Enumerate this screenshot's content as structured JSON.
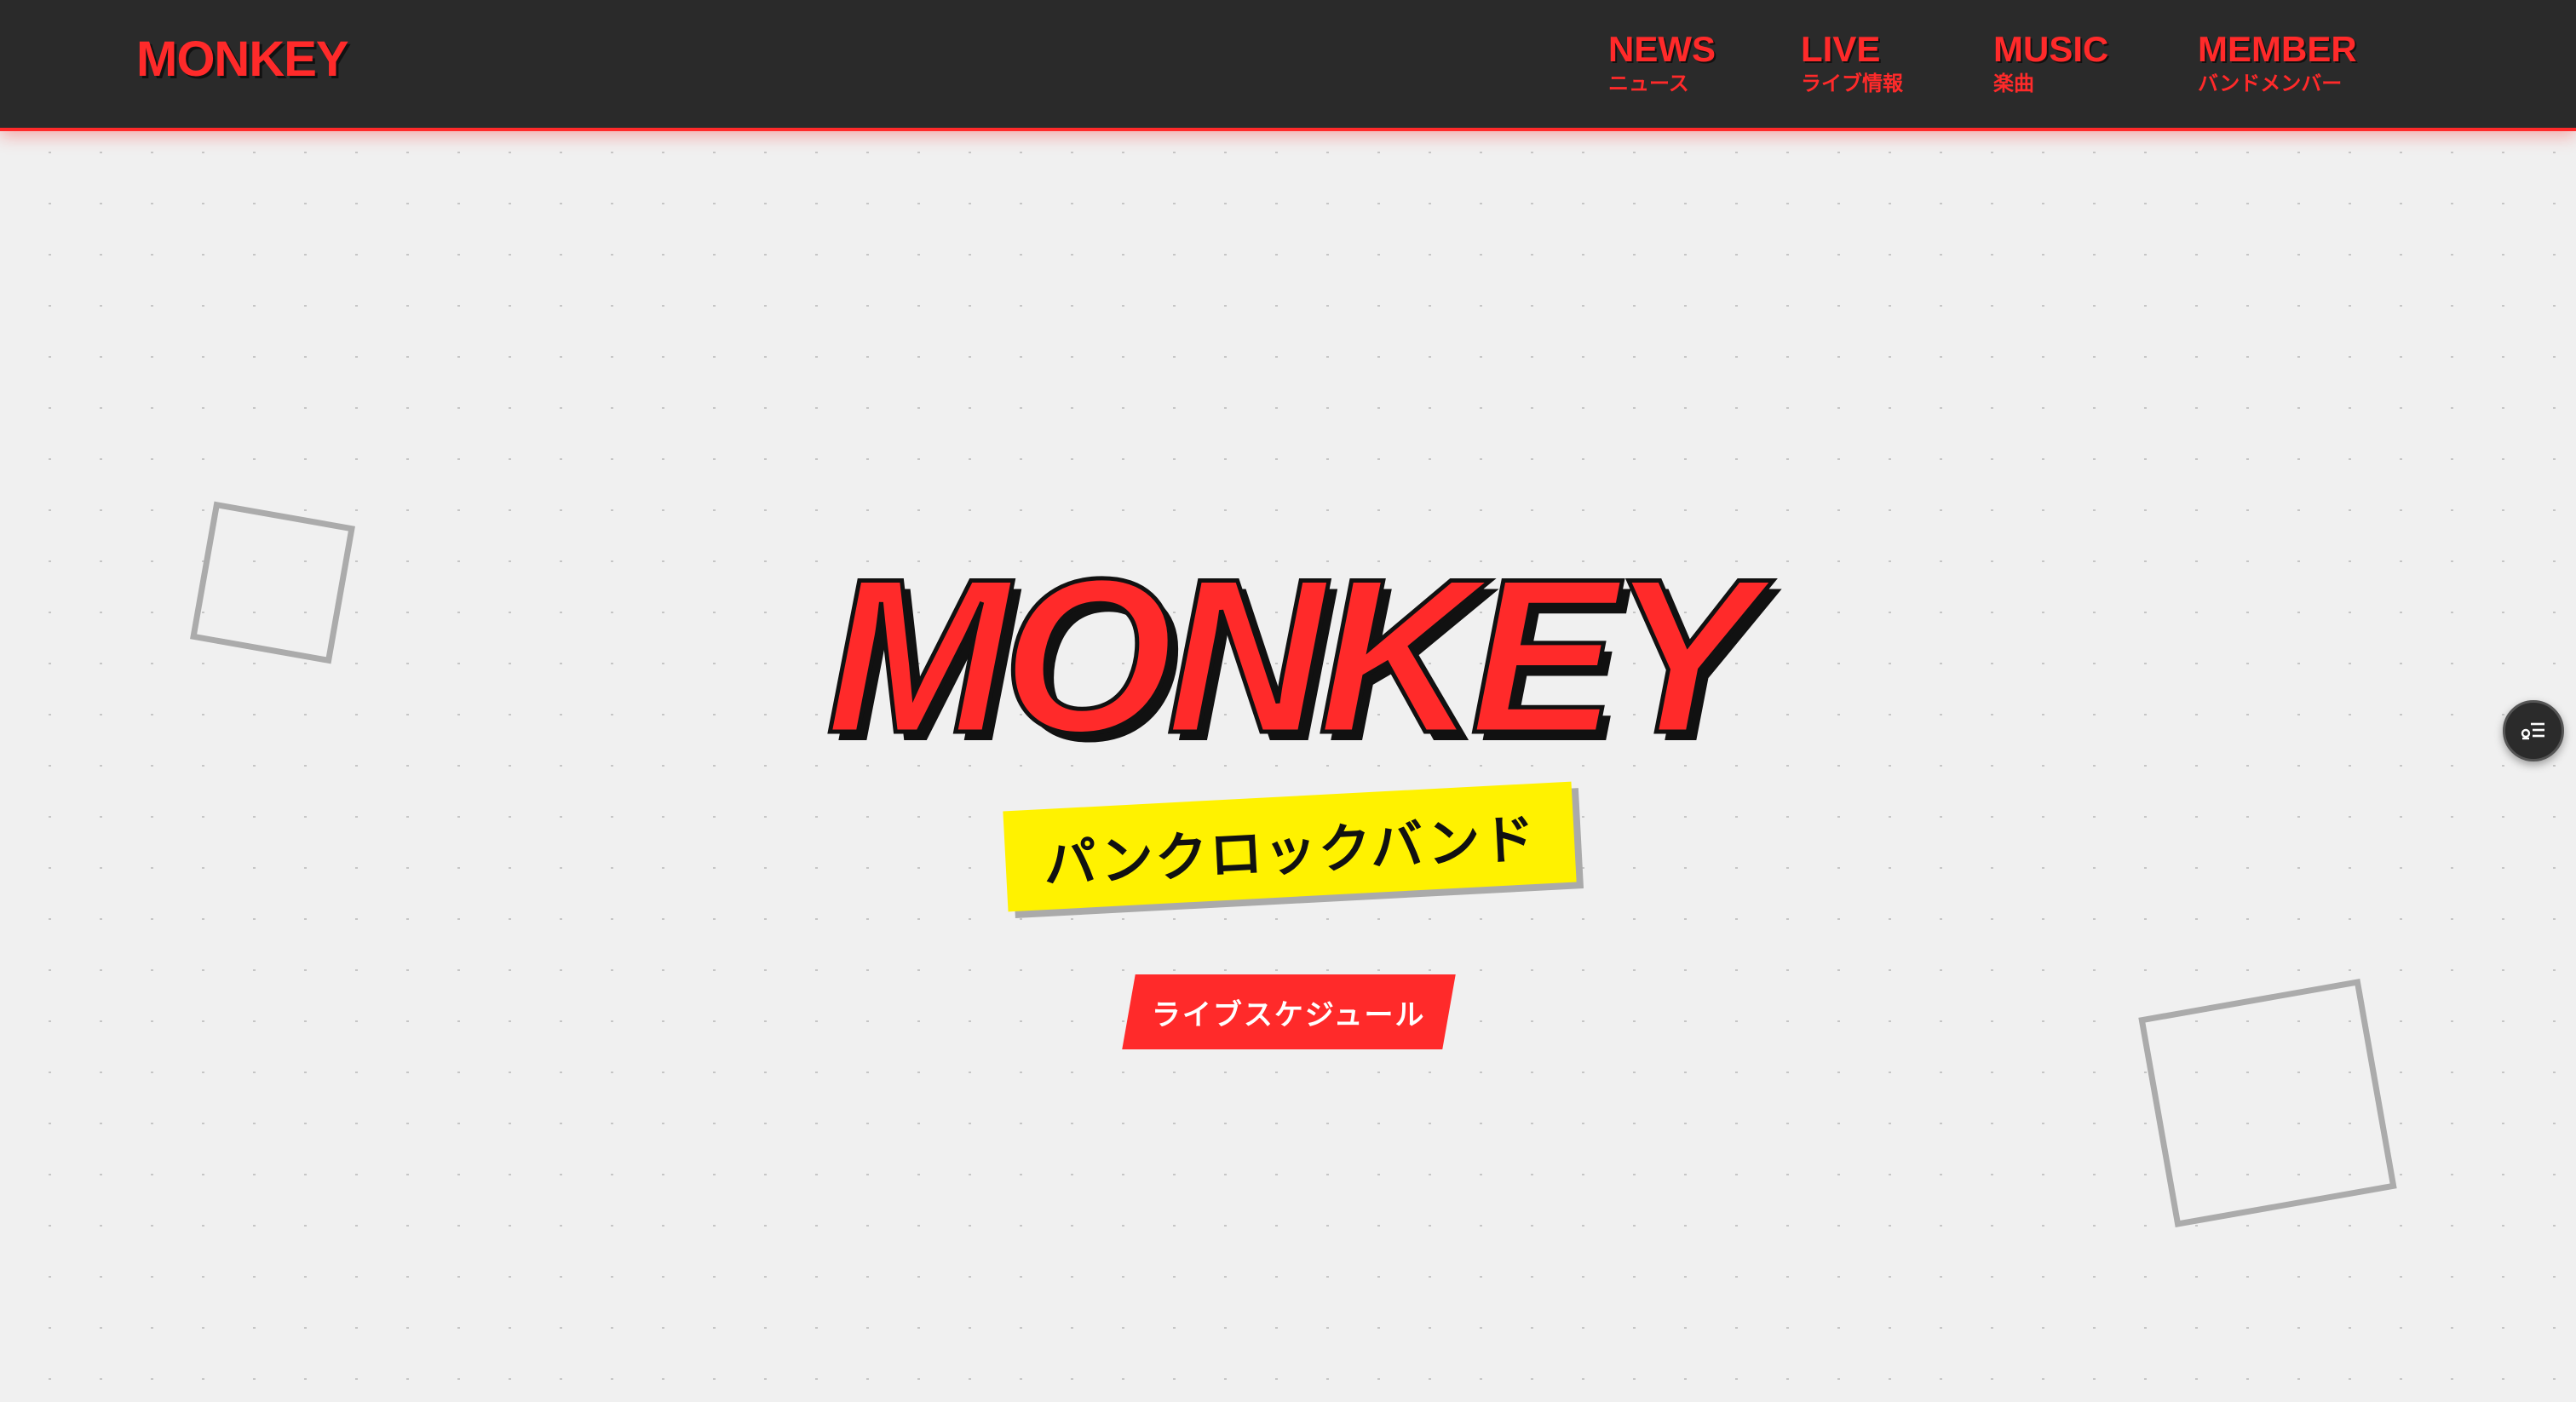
{
  "header": {
    "logo": "MONKEY",
    "nav": [
      {
        "en": "NEWS",
        "jp": "ニュース"
      },
      {
        "en": "LIVE",
        "jp": "ライブ情報"
      },
      {
        "en": "MUSIC",
        "jp": "楽曲"
      },
      {
        "en": "MEMBER",
        "jp": "バンドメンバー"
      }
    ]
  },
  "hero": {
    "title": "MONKEY",
    "subtitle": "パンクロックバンド",
    "cta_label": "ライブスケジュール"
  },
  "floating_button": {
    "icon": "list-settings-icon"
  },
  "colors": {
    "accent": "#ff2a2a",
    "header_bg": "#2a2a2a",
    "page_bg": "#f0f0f0",
    "highlight": "#fff200",
    "pattern": "#c4c4c4"
  }
}
